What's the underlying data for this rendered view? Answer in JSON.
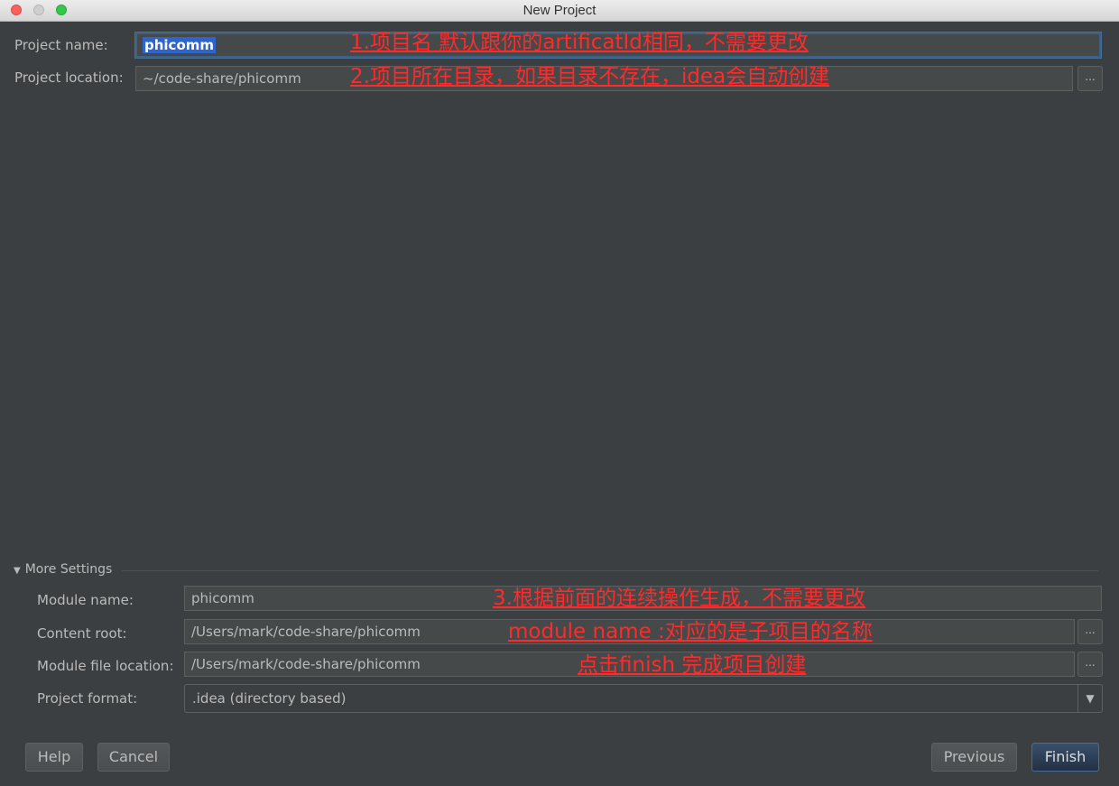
{
  "window": {
    "title": "New Project"
  },
  "project": {
    "name_label": "Project name:",
    "name_value": "phicomm",
    "location_label": "Project location:",
    "location_value": "~/code-share/phicomm",
    "browse_label": "..."
  },
  "more_settings": {
    "toggle_label": "More Settings",
    "module_name_label": "Module name:",
    "module_name_value": "phicomm",
    "content_root_label": "Content root:",
    "content_root_value": "/Users/mark/code-share/phicomm",
    "module_file_location_label": "Module file location:",
    "module_file_location_value": "/Users/mark/code-share/phicomm",
    "project_format_label": "Project format:",
    "project_format_value": ".idea (directory based)"
  },
  "annotations": {
    "a1": "1.项目名 默认跟你的artificatId相同，不需要更改",
    "a2": "2.项目所在目录，如果目录不存在，idea会自动创建",
    "a3": "3.根据前面的连续操作生成，不需要更改",
    "a4": "module name :对应的是子项目的名称",
    "a5": "点击finish  完成项目创建"
  },
  "buttons": {
    "help": "Help",
    "cancel": "Cancel",
    "previous": "Previous",
    "finish": "Finish"
  },
  "colors": {
    "background": "#3c3f41",
    "annotation": "#ff2a2a",
    "selection": "#2f65ca"
  }
}
